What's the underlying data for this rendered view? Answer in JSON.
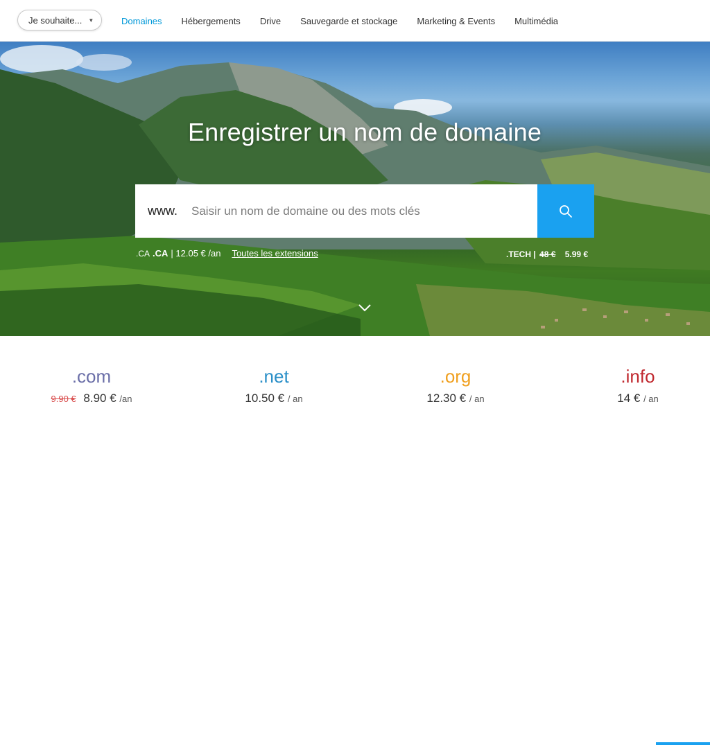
{
  "header": {
    "wish_button": "Je souhaite...",
    "nav": [
      {
        "label": "Domaines",
        "active": true
      },
      {
        "label": "Hébergements",
        "active": false
      },
      {
        "label": "Drive",
        "active": false
      },
      {
        "label": "Sauvegarde et stockage",
        "active": false
      },
      {
        "label": "Marketing & Events",
        "active": false
      },
      {
        "label": "Multimédia",
        "active": false
      }
    ]
  },
  "hero": {
    "title": "Enregistrer un nom de domaine",
    "search": {
      "prefix": "www.",
      "placeholder": "Saisir un nom de domaine ou des mots clés",
      "button_icon": "search-icon"
    },
    "ext_left": {
      "broken_image_alt": ".CA",
      "tld": ".CA",
      "price": "| 12.05 € /an",
      "all_extensions_link": "Toutes les extensions"
    },
    "ext_right": {
      "tld": ".TECH |",
      "old_price": "48 €",
      "new_price": "5.99 €"
    },
    "scroll_icon": "chevron-down-icon"
  },
  "prices": [
    {
      "tld": ".com",
      "old_price": "9.90 €",
      "price": "8.90 €",
      "per": "/an",
      "color": "#6b6fa8"
    },
    {
      "tld": ".net",
      "old_price": "",
      "price": "10.50 €",
      "per": "/ an",
      "color": "#2a8fc8"
    },
    {
      "tld": ".org",
      "old_price": "",
      "price": "12.30 €",
      "per": "/ an",
      "color": "#f0a020"
    },
    {
      "tld": ".info",
      "old_price": "",
      "price": "14 €",
      "per": "/ an",
      "color": "#c0282e"
    }
  ],
  "colors": {
    "accent": "#0098d8",
    "search_button": "#1aa1f0"
  }
}
